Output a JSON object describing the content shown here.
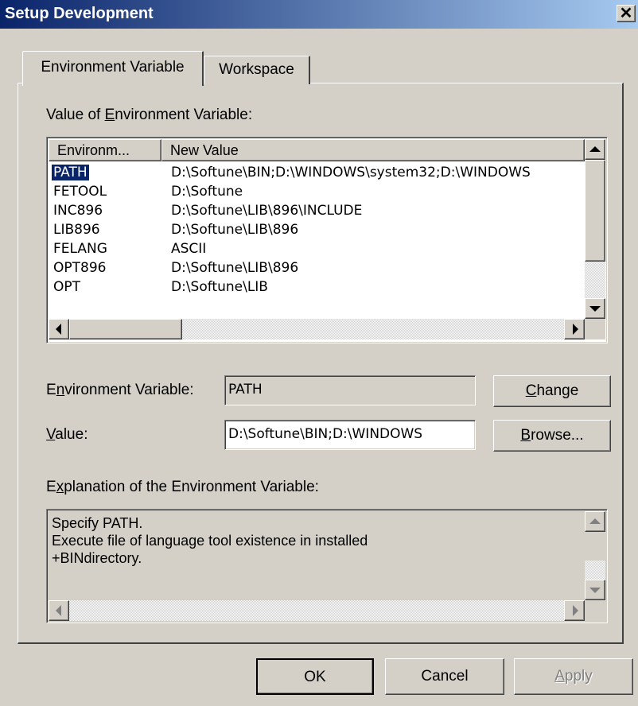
{
  "window": {
    "title": "Setup Development",
    "close_glyph": "✕"
  },
  "tabs": [
    {
      "label": "Environment Variable",
      "active": true
    },
    {
      "label": "Workspace",
      "active": false
    }
  ],
  "value_section": {
    "label_pre": "Value of ",
    "label_accel": "E",
    "label_post": "nvironment Variable:"
  },
  "list": {
    "columns": [
      "Environm...",
      "New Value"
    ],
    "rows": [
      {
        "name": "PATH",
        "value": "D:\\Softune\\BIN;D:\\WINDOWS\\system32;D:\\WINDOWS",
        "selected": true
      },
      {
        "name": "FETOOL",
        "value": "D:\\Softune"
      },
      {
        "name": "INC896",
        "value": "D:\\Softune\\LIB\\896\\INCLUDE"
      },
      {
        "name": "LIB896",
        "value": "D:\\Softune\\LIB\\896"
      },
      {
        "name": "FELANG",
        "value": "ASCII"
      },
      {
        "name": "OPT896",
        "value": "D:\\Softune\\LIB\\896"
      },
      {
        "name": "OPT",
        "value": "D:\\Softune\\LIB"
      }
    ]
  },
  "env_var": {
    "label_pre": "E",
    "label_accel": "n",
    "label_post": "vironment Variable:",
    "value": "PATH"
  },
  "value_field": {
    "label_accel": "V",
    "label_post": "alue:",
    "value": "D:\\Softune\\BIN;D:\\WINDOWS"
  },
  "buttons": {
    "change_accel": "C",
    "change_post": "hange",
    "browse_accel": "B",
    "browse_post": "rowse...",
    "ok": "OK",
    "cancel": "Cancel",
    "apply_accel": "A",
    "apply_post": "pply"
  },
  "explanation": {
    "label_pre": "E",
    "label_accel": "x",
    "label_post": "planation of the Environment Variable:",
    "text": "Specify PATH.\nExecute file of language tool existence in installed\n+BINdirectory."
  }
}
